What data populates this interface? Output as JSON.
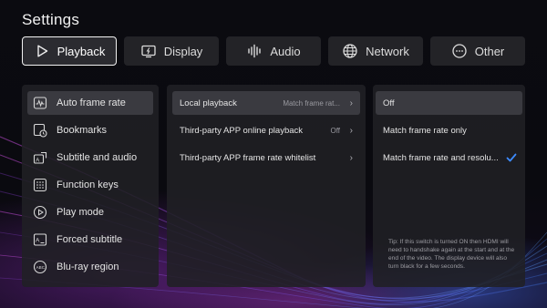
{
  "page": {
    "title": "Settings"
  },
  "tabs": [
    {
      "label": "Playback",
      "icon": "play-icon",
      "active": true
    },
    {
      "label": "Display",
      "icon": "display-icon",
      "active": false
    },
    {
      "label": "Audio",
      "icon": "audio-icon",
      "active": false
    },
    {
      "label": "Network",
      "icon": "globe-icon",
      "active": false
    },
    {
      "label": "Other",
      "icon": "more-icon",
      "active": false
    }
  ],
  "sidebar": {
    "items": [
      {
        "label": "Auto frame rate",
        "icon": "waveform-icon",
        "selected": true
      },
      {
        "label": "Bookmarks",
        "icon": "bookmark-clock-icon",
        "selected": false
      },
      {
        "label": "Subtitle and audio",
        "icon": "subtitle-audio-icon",
        "selected": false
      },
      {
        "label": "Function keys",
        "icon": "keypad-icon",
        "selected": false
      },
      {
        "label": "Play mode",
        "icon": "play-circle-icon",
        "selected": false
      },
      {
        "label": "Forced subtitle",
        "icon": "forced-subtitle-icon",
        "selected": false
      },
      {
        "label": "Blu-ray region",
        "icon": "abc-disc-icon",
        "selected": false
      }
    ]
  },
  "middle": {
    "rows": [
      {
        "label": "Local playback",
        "value": "Match frame rat...",
        "selected": true
      },
      {
        "label": "Third-party APP online playback",
        "value": "Off",
        "selected": false
      },
      {
        "label": "Third-party APP frame rate whitelist",
        "value": "",
        "selected": false
      }
    ]
  },
  "right": {
    "options": [
      {
        "label": "Off",
        "selected": true,
        "checked": false
      },
      {
        "label": "Match frame rate only",
        "selected": false,
        "checked": false
      },
      {
        "label": "Match frame rate and resolu...",
        "selected": false,
        "checked": true
      }
    ],
    "tip": "Tip: If this switch is turned ON then HDMI will need to handshake again at the start and at the end of the video. The display device will also turn black for a few seconds."
  },
  "colors": {
    "accent_check": "#3d8bff",
    "panel": "#202024",
    "selected_row": "#3a3a40"
  }
}
